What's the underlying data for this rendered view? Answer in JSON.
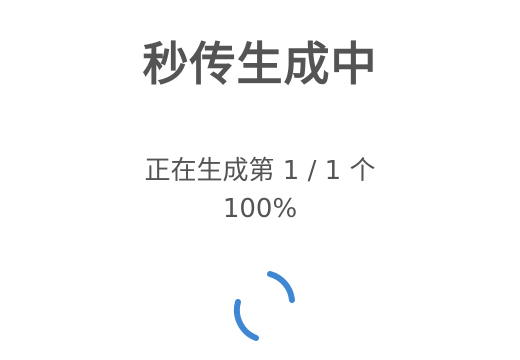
{
  "dialog": {
    "title": "秒传生成中",
    "status_text": "正在生成第 1 / 1 个",
    "progress_text": "100%",
    "progress_percent": 100,
    "spinner_icon": "loading-spinner-icon",
    "accent_color": "#3f86d3"
  }
}
